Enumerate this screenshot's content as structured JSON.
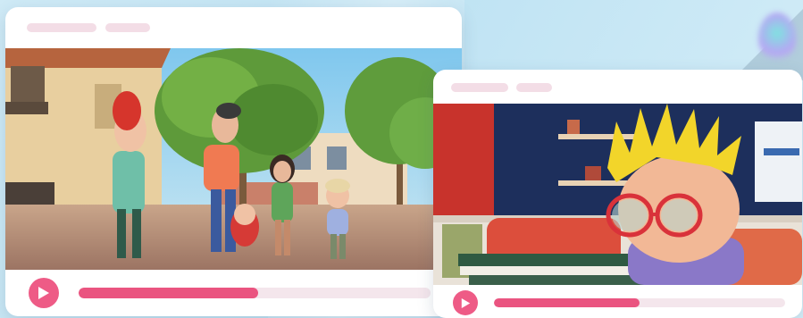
{
  "colors": {
    "accent": "#ea5480",
    "track": "#f4e6ec",
    "pill": "#f3dde6",
    "window": "#ffffff"
  },
  "icons": {
    "play": "play-icon"
  },
  "windows": [
    {
      "scene": "family-walking-street",
      "progress_percent": 51
    },
    {
      "scene": "boy-with-glasses-kitchen",
      "progress_percent": 50
    }
  ]
}
